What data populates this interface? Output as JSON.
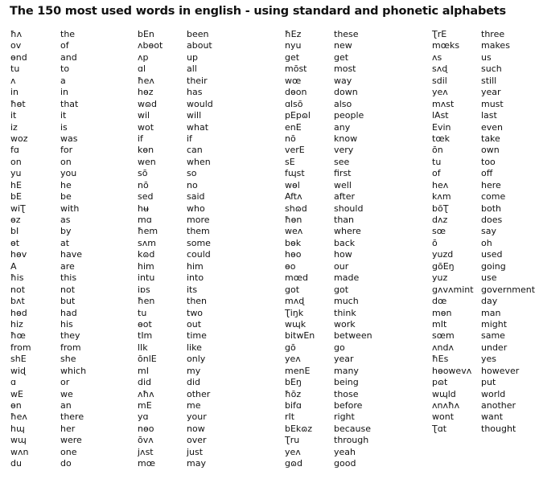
{
  "title": "The 150 most used words in english -  using standard and phonetic alphabets",
  "columns": [
    {
      "phonetic": [
        "ħʌ",
        "ov",
        "ɵnd",
        "tu",
        "ʌ",
        "in",
        "ħɵt",
        "it",
        "iz",
        "woz",
        "fɑ",
        "on",
        "yu",
        "hE",
        "bE",
        "wiƮ",
        "ɵz",
        "bI",
        "ɵt",
        "hɵv",
        "A",
        "ħis",
        "not",
        "bʌt",
        "hɵd",
        "hiz",
        "ħœ",
        "from",
        "shE",
        "wiɖ",
        "ɑ",
        "wE",
        "ɵn",
        "ħeʌ",
        "hɰ",
        "wɰ",
        "wʌn",
        "du"
      ],
      "standard": [
        "the",
        "of",
        "and",
        "to",
        "a",
        "in",
        "that",
        "it",
        "is",
        "was",
        "for",
        "on",
        "you",
        "he",
        "be",
        "with",
        "as",
        "by",
        "at",
        "have",
        "are",
        "this",
        "not",
        "but",
        "had",
        "his",
        "they",
        "from",
        "she",
        "which",
        "or",
        "we",
        "an",
        "there",
        "her",
        "were",
        "one",
        "do"
      ]
    },
    {
      "phonetic": [
        "bEn",
        "ʌbɵot",
        "ʌp",
        "ɑl",
        "ħeʌ",
        "hɵz",
        "wɷd",
        "wil",
        "wot",
        "if",
        "kɵn",
        "wen",
        "sō",
        "nō",
        "sed",
        "hʉ",
        "mɑ",
        "ħem",
        "sʌm",
        "kɷd",
        "him",
        "intu",
        "iɒs",
        "ħen",
        "tu",
        "ɵot",
        "tIm",
        "lIk",
        "ōnlE",
        "mI",
        "did",
        "ʌħʌ",
        "mE",
        "yɑ",
        "nɵo",
        "ōvʌ",
        "jʌst",
        "mœ"
      ],
      "standard": [
        "been",
        "about",
        "up",
        "all",
        "their",
        "has",
        "would",
        "will",
        "what",
        "if",
        "can",
        "when",
        "so",
        "no",
        "said",
        "who",
        "more",
        "them",
        "some",
        "could",
        "him",
        "into",
        "its",
        "then",
        "two",
        "out",
        "time",
        "like",
        "only",
        "my",
        "did",
        "other",
        "me",
        "your",
        "now",
        "over",
        "just",
        "may"
      ]
    },
    {
      "phonetic": [
        "ħEz",
        "nyu",
        "get",
        "mōst",
        "wœ",
        "dɵon",
        "ɑlsō",
        "pEpɷl",
        "enE",
        "nō",
        "verE",
        "sE",
        "fɰst",
        "wɵl",
        "Aftʌ",
        "shɷd",
        "ħɵn",
        "weʌ",
        "bɵk",
        "hɵo",
        "ɵo",
        "mœd",
        "got",
        "mʌɖ",
        "Ʈiŋk",
        "wɰk",
        "bitwEn",
        "gō",
        "yeʌ",
        "menE",
        "bEŋ",
        "ħōz",
        "bifɑ",
        "rIt",
        "bEkɷz",
        "Ʈru",
        "yeʌ",
        "gɷd"
      ],
      "standard": [
        "these",
        "new",
        "get",
        "most",
        "way",
        "down",
        "also",
        "people",
        "any",
        "know",
        "very",
        "see",
        "first",
        "well",
        "after",
        "should",
        "than",
        "where",
        "back",
        "how",
        "our",
        "made",
        "got",
        "much",
        "think",
        "work",
        "between",
        "go",
        "year",
        "many",
        "being",
        "those",
        "before",
        "right",
        "because",
        "through",
        "yeah",
        "good"
      ]
    },
    {
      "phonetic": [
        "ƮrE",
        "mœks",
        "ʌs",
        "sʌɖ",
        "sdil",
        "yeʌ",
        "mʌst",
        "lAst",
        "Evin",
        "tœk",
        "ōn",
        "tu",
        "of",
        "heʌ",
        "kʌm",
        "bōƮ",
        "dʌz",
        "sœ",
        "ō",
        "yuzd",
        "gōEŋ",
        "yuz",
        "gʌvʌmint",
        "dœ",
        "mɵn",
        "mIt",
        "sœm",
        "ʌndʌ",
        "ħEs",
        "hɵowevʌ",
        "pɷt",
        "wɰld",
        "ʌnʌħʌ",
        "wont",
        "Ʈɑt"
      ],
      "standard": [
        "three",
        "makes",
        "us",
        "such",
        "still",
        "year",
        "must",
        "last",
        "even",
        "take",
        "own",
        "too",
        "off",
        "here",
        "come",
        "both",
        "does",
        "say",
        "oh",
        "used",
        "going",
        "use",
        "government",
        "day",
        "man",
        "might",
        "same",
        "under",
        "yes",
        "however",
        "put",
        "world",
        "another",
        "want",
        "thought"
      ]
    }
  ]
}
